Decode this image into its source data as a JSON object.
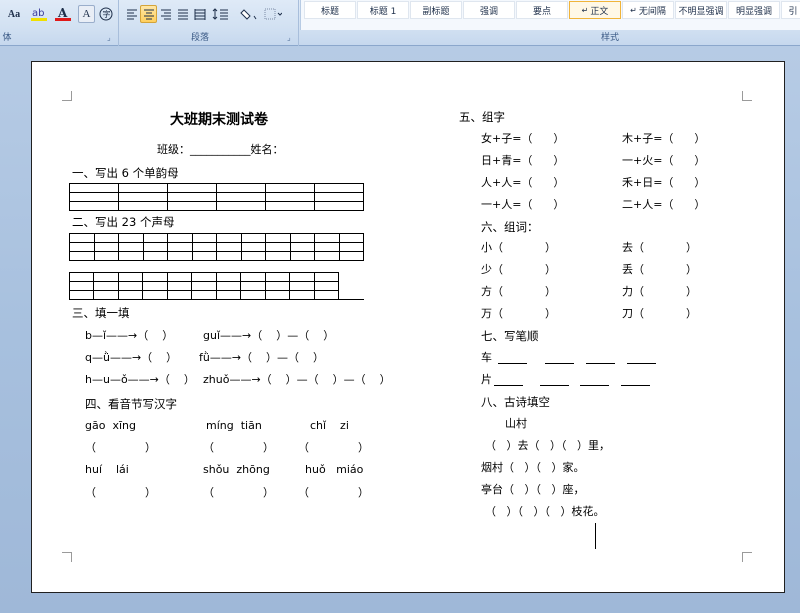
{
  "ribbon": {
    "font_group_label": "体",
    "paragraph_group_label": "段落",
    "styles_group_label": "样式",
    "font_buttons": [
      "Aa",
      "A",
      "A"
    ],
    "styles": [
      "标题",
      "标题 1",
      "副标题",
      "强调",
      "要点",
      "正文",
      "无间隔",
      "不明显强调",
      "明显强调",
      "引"
    ],
    "current_style": "正文",
    "accent_color": "#ffcf5d",
    "highlight_color": "#f0e000",
    "font_color": "#e01818"
  },
  "doc": {
    "title": "大班期末测试卷",
    "class_line": "班级：___________姓名：",
    "s1": "一、写出 6 个单韵母",
    "s2": "二、写出 23 个声母",
    "s3": "三、填一填",
    "s3_lines": [
      [
        "b—ǐ——→（    ）",
        "guǐ——→（    ）—（    ）"
      ],
      [
        "q—ǜ——→（    ）",
        "fǜ——→（    ）—（    ）"
      ],
      [
        "h—u—ǒ——→（    ）",
        "zhuǒ——→（    ）—（    ）—（    ）"
      ]
    ],
    "s4": "四、看音节写汉字",
    "s4_pinyin1": [
      "gāo  xīng",
      "míng  tiān",
      "chǐ    zi"
    ],
    "s4_pinyin2": [
      "huí    lái",
      "shǒu  zhōng",
      "huǒ   miáo"
    ],
    "blank_paren": "（              ）",
    "s5": "五、组字",
    "s5_rows": [
      [
        "女+子=（      ）",
        "木+子=（      ）"
      ],
      [
        "日+青=（      ）",
        "一+火=（      ）"
      ],
      [
        "人+人=（      ）",
        "禾+日=（      ）"
      ],
      [
        "一+人=（      ）",
        "二+人=（      ）"
      ]
    ],
    "s6": "六、组词：",
    "s6_rows": [
      [
        "小（            ）",
        "去（            ）"
      ],
      [
        "少（            ）",
        "丢（            ）"
      ],
      [
        "方（            ）",
        "力（            ）"
      ],
      [
        "万（            ）",
        "刀（            ）"
      ]
    ],
    "s7": "七、写笔顺",
    "s7_chars": [
      "车",
      "片"
    ],
    "s8": "八、古诗填空",
    "poem_title": "山村",
    "poem_lines": [
      "（   ）去（   ）（   ）里，",
      "烟村（   ）（   ）家。",
      "亭台（   ）（   ）座，",
      "（   ）（   ）（   ）枝花。"
    ]
  }
}
